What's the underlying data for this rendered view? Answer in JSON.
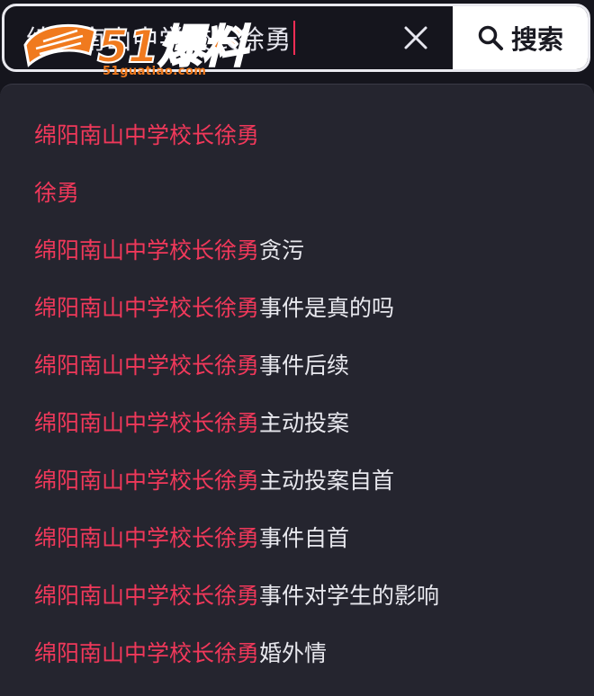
{
  "search": {
    "value": "绵阳南山中学校长徐勇",
    "button_label": "搜索"
  },
  "logo": {
    "text": "51爆料",
    "url": "51guatiao.com"
  },
  "suggestions": [
    {
      "match": "绵阳南山中学校长徐勇",
      "rest": ""
    },
    {
      "match": "徐勇",
      "rest": ""
    },
    {
      "match": "绵阳南山中学校长徐勇",
      "rest": "贪污"
    },
    {
      "match": "绵阳南山中学校长徐勇",
      "rest": "事件是真的吗"
    },
    {
      "match": "绵阳南山中学校长徐勇",
      "rest": "事件后续"
    },
    {
      "match": "绵阳南山中学校长徐勇",
      "rest": "主动投案"
    },
    {
      "match": "绵阳南山中学校长徐勇",
      "rest": "主动投案自首"
    },
    {
      "match": "绵阳南山中学校长徐勇",
      "rest": "事件自首"
    },
    {
      "match": "绵阳南山中学校长徐勇",
      "rest": "事件对学生的影响"
    },
    {
      "match": "绵阳南山中学校长徐勇",
      "rest": "婚外情"
    }
  ],
  "colors": {
    "highlight": "#f0385a",
    "text": "#e8e8ee",
    "panel": "#25252f",
    "background": "#15151d",
    "logo": "#f07a1e"
  }
}
